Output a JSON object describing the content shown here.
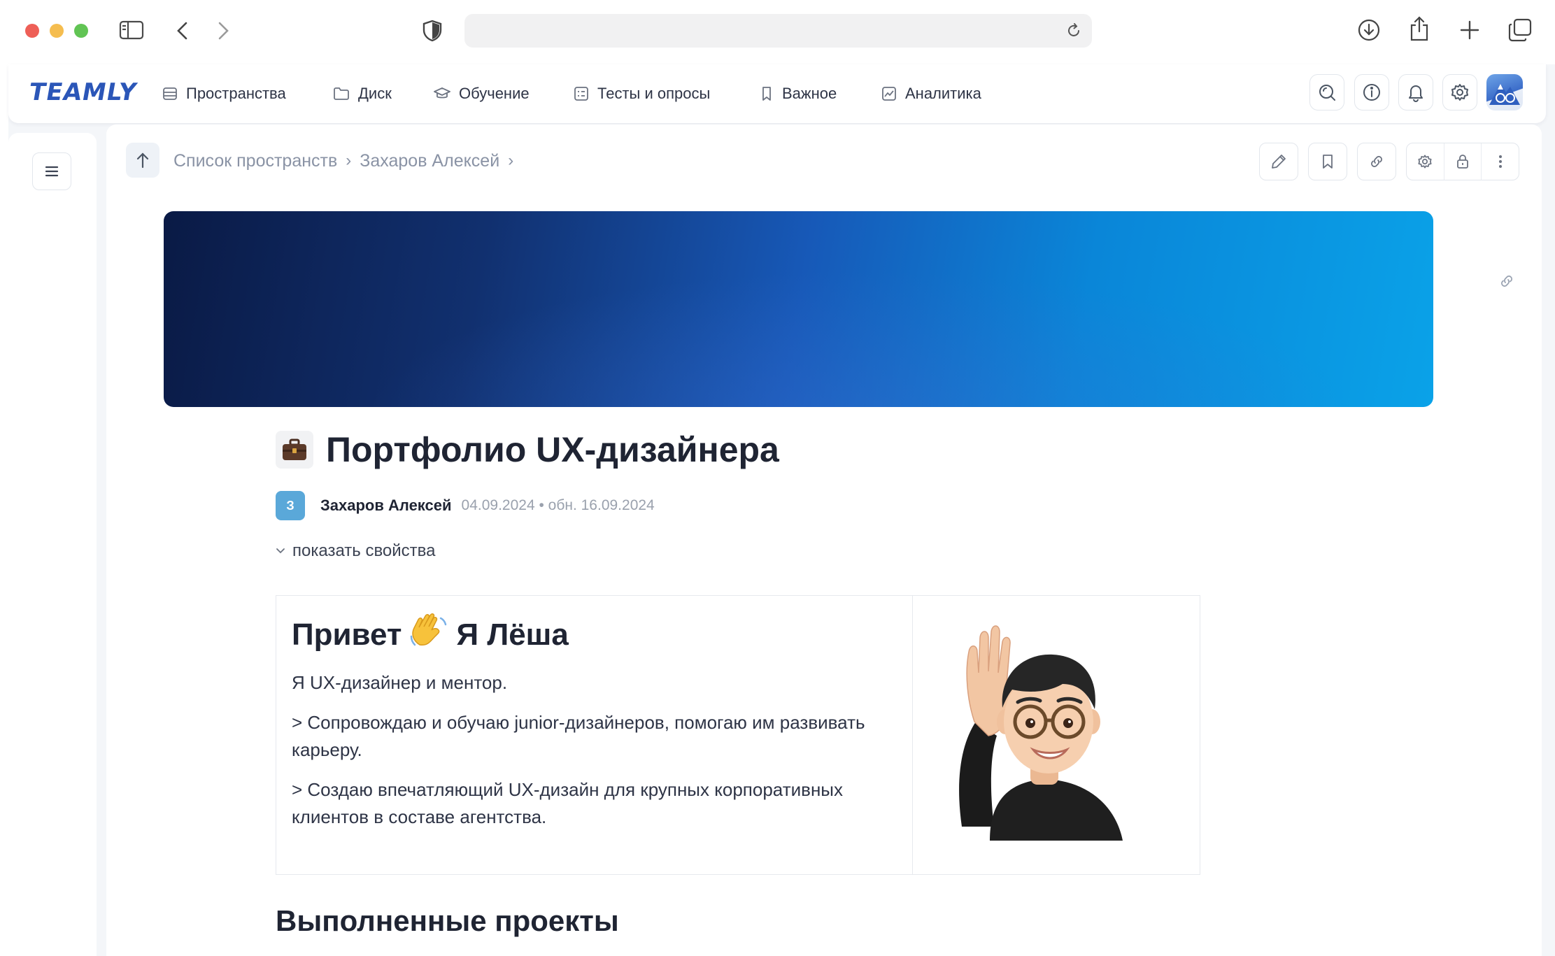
{
  "browser": {
    "url": ""
  },
  "app": {
    "logo_text": "TEAMLY",
    "brand_color": "#2b56b8",
    "nav": [
      {
        "label": "Пространства",
        "icon": "spaces-icon"
      },
      {
        "label": "Диск",
        "icon": "folder-icon"
      },
      {
        "label": "Обучение",
        "icon": "graduation-cap-icon"
      },
      {
        "label": "Тесты и опросы",
        "icon": "checklist-icon"
      },
      {
        "label": "Важное",
        "icon": "bookmark-icon"
      },
      {
        "label": "Аналитика",
        "icon": "chart-icon"
      }
    ],
    "nav_right_icons": [
      "search-icon",
      "info-icon",
      "bell-icon",
      "gear-icon",
      "avatar"
    ]
  },
  "breadcrumb": {
    "items": [
      "Список пространств",
      "Захаров Алексей"
    ]
  },
  "toolbar": {
    "icons": [
      "pencil-icon",
      "bookmark-icon",
      "link-icon",
      "gear-icon",
      "lock-icon",
      "more-icon"
    ]
  },
  "page": {
    "emoji": "💼",
    "title": "Портфолио UX-дизайнера",
    "author": {
      "initial": "З",
      "name": "Захаров Алексей",
      "dates": "04.09.2024 • обн. 16.09.2024",
      "avatar_color": "#5aa8d9"
    },
    "show_properties": "показать свойства"
  },
  "intro": {
    "heading_part1": "Привет",
    "heading_emoji": "👋",
    "heading_part2": "Я Лёша",
    "paragraphs": [
      "Я UX-дизайнер и ментор.",
      "> Сопровождаю и обучаю junior-дизайнеров, помогаю им развивать карьеру.",
      "> Создаю впечатляющий UX-дизайн для крупных корпоративных клиентов в составе агентства."
    ]
  },
  "sections": {
    "projects_heading": "Выполненные проекты"
  }
}
